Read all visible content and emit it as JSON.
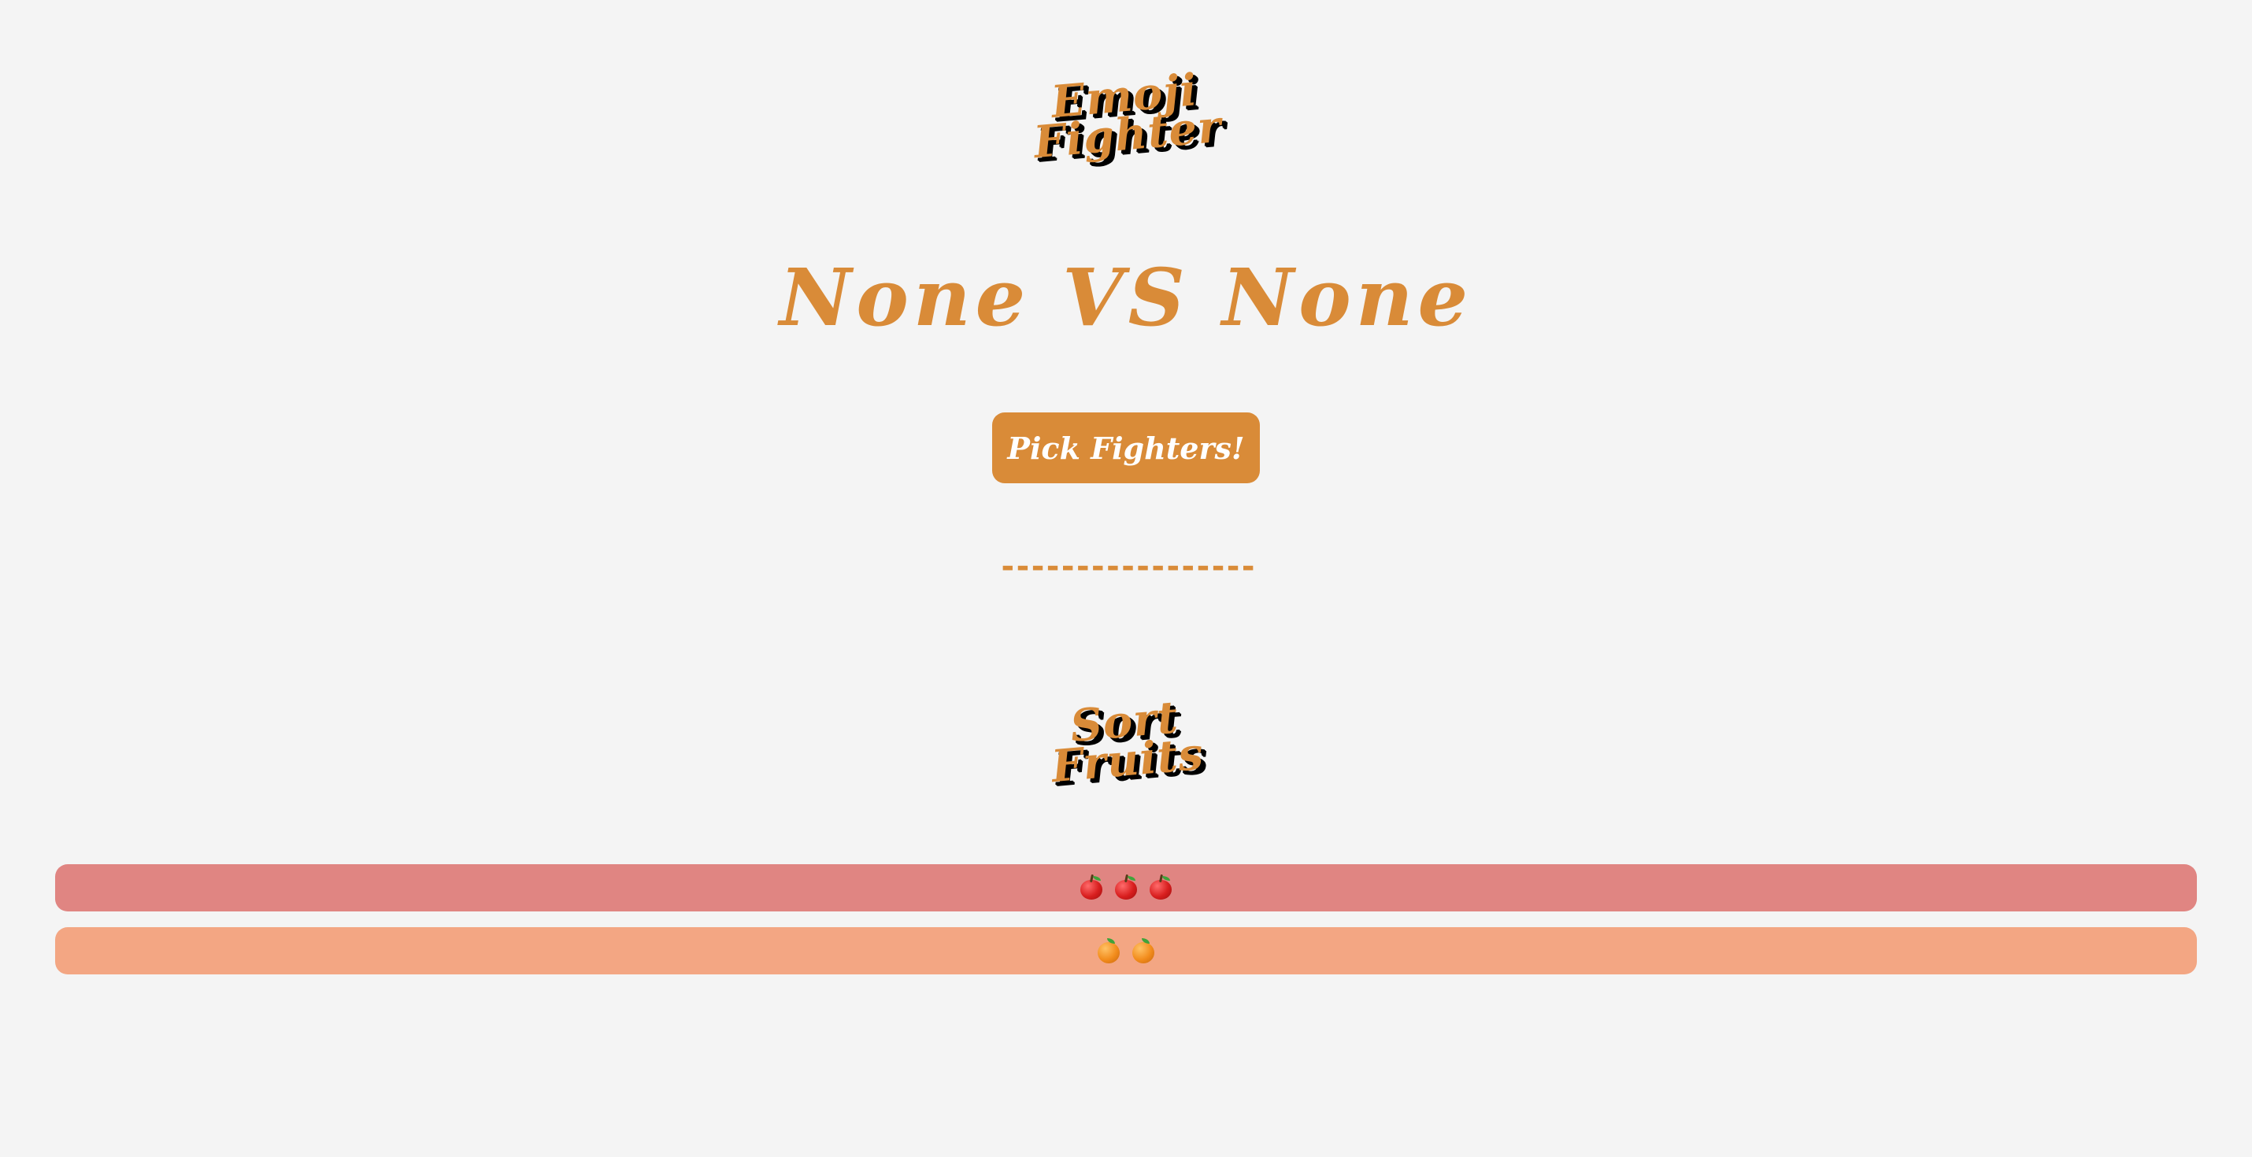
{
  "header": {
    "logo_line1": "Emoji",
    "logo_line2": "Fighter"
  },
  "matchup": {
    "text": "None VS None"
  },
  "pick_button": {
    "label": "Pick Fighters!"
  },
  "divider": {
    "text": "-----------------"
  },
  "sort_section": {
    "title_line1": "Sort",
    "title_line2": "Fruits",
    "rows": [
      {
        "fruit": "apple-icon",
        "count": 3,
        "color": "#e08582"
      },
      {
        "fruit": "orange-icon",
        "count": 2,
        "color": "#f3a683"
      }
    ]
  },
  "colors": {
    "accent": "#d98b38",
    "background": "#f4f4f4",
    "shadow": "#000000"
  }
}
